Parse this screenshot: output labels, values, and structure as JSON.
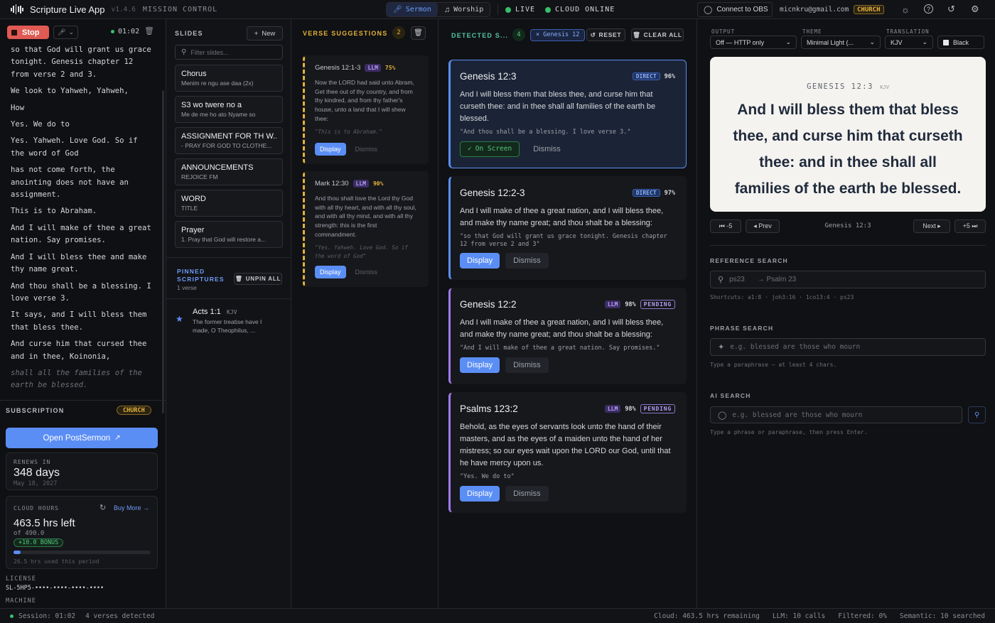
{
  "app": {
    "title": "Scripture Live App",
    "version": "v1.4.6",
    "mode": "MISSION CONTROL"
  },
  "topbar": {
    "tab_sermon": "Sermon",
    "tab_worship": "Worship",
    "live": "LIVE",
    "cloud": "CLOUD ONLINE",
    "obs": "Connect to OBS",
    "email": "micnkru@gmail.com",
    "plan": "CHURCH"
  },
  "transcript": {
    "stop": "Stop",
    "timer": "01:02",
    "lines": [
      "so that God will grant us grace tonight. Genesis chapter 12 from verse 2 and 3.",
      "We look to Yahweh, Yahweh,",
      "How",
      "Yes. We do to",
      "Yes. Yahweh. Love God. So if the word of God",
      "has not come forth, the anointing does not have an assignment.",
      "This is to Abraham.",
      "And I will make of thee a great nation. Say promises.",
      "And I will bless thee and make thy name great.",
      "And thou shall be a blessing. I love verse 3.",
      "It says, and I will bless them that bless thee.",
      "And curse him that cursed thee and in thee, Koinonia,"
    ],
    "interim": "shall all the families of the earth be blessed."
  },
  "subscription": {
    "heading": "SUBSCRIPTION",
    "plan": "CHURCH",
    "open_btn": "Open PostSermon",
    "renews_label": "RENEWS IN",
    "renews_value": "348 days",
    "renews_date": "May 18, 2027",
    "cloud_label": "CLOUD HOURS",
    "buy_more": "Buy More →",
    "hours_left": "463.5 hrs left",
    "hours_of": "of 490.0",
    "bonus": "+10.0 BONUS",
    "used": "26.5 hrs used this period",
    "usage_fraction": 0.054,
    "license_label": "LICENSE",
    "license_value": "SL-5HP5-••••-••••-••••-••••",
    "machine_label": "MACHINE"
  },
  "slides": {
    "heading": "SLIDES",
    "new_btn": "New",
    "filter_placeholder": "Filter slides...",
    "items": [
      {
        "title": "Chorus",
        "sub": "Menim re ngu ase daa (2x)"
      },
      {
        "title": "S3 wo twere no a",
        "sub": "Me de me ho ato Nyame so"
      },
      {
        "title": "ASSIGNMENT FOR TH W...",
        "sub": "- PRAY FOR GOD TO CLOTHE..."
      },
      {
        "title": "ANNOUNCEMENTS",
        "sub": "REJOICE FM"
      },
      {
        "title": "WORD",
        "sub": "TITLE"
      },
      {
        "title": "Prayer",
        "sub": "1. Pray that God will restore a..."
      }
    ],
    "pinned_heading": "PINNED SCRIPTURES",
    "pinned_count": "1 verse",
    "unpin_all": "UNPIN ALL",
    "pinned": {
      "ref": "Acts 1:1",
      "translation": "KJV",
      "text": "The former treatise have I made, O Theophilus, ..."
    }
  },
  "suggestions": {
    "heading": "VERSE SUGGESTIONS",
    "count": "2",
    "items": [
      {
        "ref": "Genesis 12:1-3",
        "tag": "LLM",
        "conf": "75%",
        "text": "Now the LORD had said unto Abram, Get thee out of thy country, and from thy kindred, and from thy father's house, unto a land that I will shew thee:",
        "quote": "\"This is to Abraham.\"",
        "display": "Display",
        "dismiss": "Dismiss"
      },
      {
        "ref": "Mark 12:30",
        "tag": "LLM",
        "conf": "90%",
        "text": "And thou shalt love the Lord thy God with all thy heart, and with all thy soul, and with all thy mind, and with all thy strength: this is the first commandment.",
        "quote": "\"Yes. Yahweh. Love God. So if the word of God\"",
        "display": "Display",
        "dismiss": "Dismiss"
      }
    ]
  },
  "detected": {
    "heading": "DETECTED S...",
    "count": "4",
    "filter": "× Genesis 12",
    "reset": "RESET",
    "clear_all": "CLEAR ALL",
    "items": [
      {
        "ref": "Genesis 12:3",
        "tag": "DIRECT",
        "conf": "96%",
        "text": "And I will bless them that bless thee, and curse him that curseth thee: and in thee shall all families of the earth be blessed.",
        "quote": "\"And thou shall be a blessing. I love verse 3.\"",
        "on_screen": "On Screen",
        "dismiss": "Dismiss"
      },
      {
        "ref": "Genesis 12:2-3",
        "tag": "DIRECT",
        "conf": "97%",
        "text": "And I will make of thee a great nation, and I will bless thee, and make thy name great; and thou shalt be a blessing:",
        "quote": "\"so that God will grant us grace tonight. Genesis chapter 12 from verse 2 and 3\"",
        "display": "Display",
        "dismiss": "Dismiss"
      },
      {
        "ref": "Genesis 12:2",
        "tag": "LLM",
        "conf": "98%",
        "status": "PENDING",
        "text": "And I will make of thee a great nation, and I will bless thee, and make thy name great; and thou shalt be a blessing:",
        "quote": "\"And I will make of thee a great nation. Say promises.\"",
        "display": "Display",
        "dismiss": "Dismiss"
      },
      {
        "ref": "Psalms 123:2",
        "tag": "LLM",
        "conf": "98%",
        "status": "PENDING",
        "text": "Behold, as the eyes of servants look unto the hand of their masters, and as the eyes of a maiden unto the hand of her mistress; so our eyes wait upon the LORD our God, until that he have mercy upon us.",
        "quote": "\"Yes. We do to\"",
        "display": "Display",
        "dismiss": "Dismiss"
      }
    ]
  },
  "output": {
    "output_label": "OUTPUT",
    "output_value": "Off — HTTP only",
    "theme_label": "THEME",
    "theme_value": "Minimal Light (...",
    "translation_label": "TRANSLATION",
    "translation_value": "KJV",
    "black": "Black",
    "preview_ref": "GENESIS 12:3",
    "preview_trans": "KJV",
    "preview_text": "And I will bless them that bless thee, and curse him that curseth thee: and in thee shall all families of the earth be blessed.",
    "nav_back5": "⏮ -5",
    "nav_prev": "◂ Prev",
    "nav_current": "Genesis 12:3",
    "nav_next": "Next ▸",
    "nav_fwd5": "+5 ⏭",
    "ref_search_heading": "REFERENCE SEARCH",
    "ref_search_placeholder": "ps23",
    "ref_search_hint": "→ Psalm 23",
    "shortcuts": "Shortcuts: a1:8 · joh3:16 · 1co13:4 · ps23",
    "phrase_heading": "PHRASE SEARCH",
    "phrase_placeholder": "e.g. blessed are those who mourn",
    "phrase_hint": "Type a paraphrase — at least 4 chars.",
    "ai_heading": "AI SEARCH",
    "ai_placeholder": "e.g. blessed are those who mourn",
    "ai_hint": "Type a phrase or paraphrase, then press Enter."
  },
  "status": {
    "session": "Session: 01:02",
    "verses": "4 verses detected",
    "cloud": "Cloud: 463.5 hrs remaining",
    "llm": "LLM: 10 calls",
    "filtered": "Filtered: 0%",
    "semantic": "Semantic: 10 searched"
  },
  "colors": {
    "accent": "#5b8ef5",
    "live": "#36c06a",
    "gold": "#e4b23a",
    "llm": "#9f7aea"
  }
}
